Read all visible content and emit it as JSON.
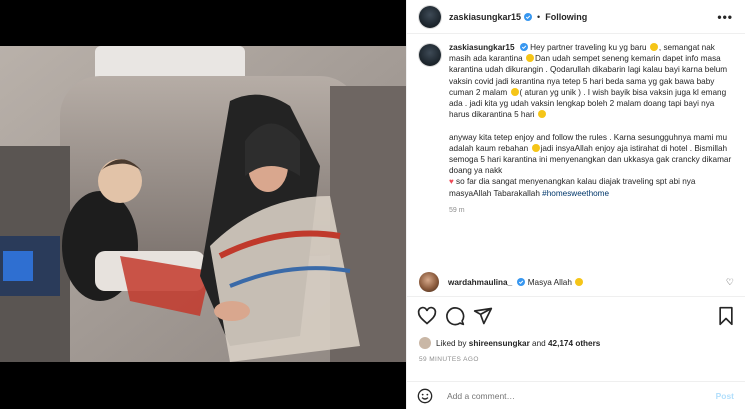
{
  "post": {
    "author": "zaskiasungkar15",
    "following_label": "Following",
    "more_label": "•••"
  },
  "caption": {
    "author": "zaskiasungkar15",
    "p1": "Hey partner traveling ku yg baru",
    "p1b": ", semangat nak masih ada karantina",
    "p1c": "Dan udah sempet seneng kemarin dapet info masa karantina udah dikurangin . Qodarullah dikabarin lagi kalau bayi karna belum vaksin covid jadi karantina nya tetep 5 hari beda sama yg gak bawa baby cuman 2 malam",
    "p1d": "( aturan yg unik ) . I wish bayik bisa vaksin juga kl emang ada . jadi kita yg udah vaksin lengkap boleh 2 malam doang tapi bayi nya harus dikarantina 5 hari",
    "p2": "anyway kita tetep enjoy and follow the rules . Karna sesungguhnya mami mu adalah kaum rebahan",
    "p2b": "jadi insyaAllah enjoy aja istirahat di hotel . Bismillah semoga 5 hari karantina ini menyenangkan dan ukkasya gak crancky dikamar doang ya nakk",
    "p2c": "so far dia sangat menyenangkan kalau diajak traveling spt abi nya masyaAllah Tabarakallah",
    "hashtag": "#homesweethome",
    "time": "59 m"
  },
  "comment": {
    "author": "wardahmaulina_",
    "text": "Masya Allah"
  },
  "likes": {
    "prefix": "Liked by",
    "user": "shireensungkar",
    "middle": "and",
    "count": "42,174 others"
  },
  "timestamp": "59 MINUTES AGO",
  "add_comment": {
    "placeholder": "Add a comment…",
    "post_label": "Post"
  },
  "icons": {
    "more": "more-options-icon",
    "verified": "verified-badge-icon",
    "like": "heart-icon",
    "comment": "comment-icon",
    "share": "share-icon",
    "save": "bookmark-icon",
    "emoji": "smiley-icon"
  },
  "colors": {
    "link": "#00376b",
    "verified": "#3897f0",
    "muted": "#8e8e8e",
    "post_btn": "#b2dffc"
  }
}
